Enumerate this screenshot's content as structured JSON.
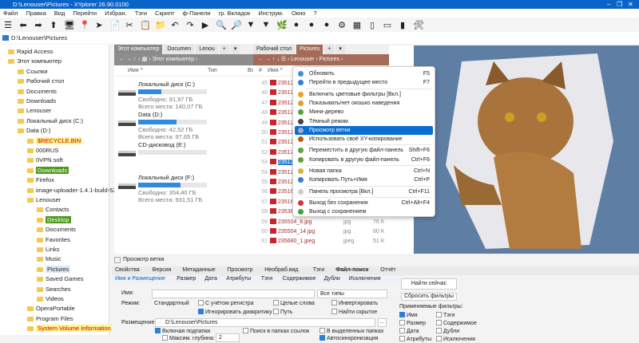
{
  "window": {
    "title": "D:\\Lenouser\\Pictures - XYplorer 26.90.0100",
    "min": "–",
    "max": "❐",
    "close": "✕"
  },
  "menu": [
    "Файл",
    "Правка",
    "Вид",
    "Перейти",
    "Избран.",
    "Тэги",
    "Скрипт",
    "ф-Панели",
    "гр. Вкладок",
    "Инструм.",
    "Окно",
    "?"
  ],
  "toolbar": [
    "☰",
    "⬅",
    "➡",
    "⬆",
    "🖥",
    "📍",
    "➤",
    "📄",
    "✂",
    "📋",
    "📁",
    "↶",
    "↷",
    "▶",
    "🔍",
    "🔎",
    "▼",
    "▼",
    "🌿",
    "●",
    "●",
    "●",
    "⚙",
    "▦",
    "▯",
    "▭",
    "▮",
    "🛠"
  ],
  "address": "D:\\Lenouser\\Pictures",
  "tree": [
    {
      "label": "Rapid Access",
      "lvl": 0
    },
    {
      "label": "Этот компьютер",
      "lvl": 0
    },
    {
      "label": "Ссылки",
      "lvl": 1
    },
    {
      "label": "Рабочий стол",
      "lvl": 1
    },
    {
      "label": "Documents",
      "lvl": 1
    },
    {
      "label": "Downloads",
      "lvl": 1
    },
    {
      "label": "Lenouser",
      "lvl": 1
    },
    {
      "label": "Локальный диск (C:)",
      "lvl": 1
    },
    {
      "label": "Data (D:)",
      "lvl": 1
    },
    {
      "label": "$RECYCLE.BIN",
      "lvl": 2,
      "hl": "y"
    },
    {
      "label": "000RUS",
      "lvl": 2
    },
    {
      "label": "0VPN soft",
      "lvl": 2
    },
    {
      "label": "Downloads",
      "lvl": 2,
      "hl": "g"
    },
    {
      "label": "Firefox",
      "lvl": 2
    },
    {
      "label": "image-uploader-1.4.1-build-5219",
      "lvl": 2
    },
    {
      "label": "Lenouser",
      "lvl": 2
    },
    {
      "label": "Contacts",
      "lvl": 3
    },
    {
      "label": "Desktop",
      "lvl": 3,
      "hl": "g"
    },
    {
      "label": "Documents",
      "lvl": 3
    },
    {
      "label": "Favorites",
      "lvl": 3
    },
    {
      "label": "Links",
      "lvl": 3
    },
    {
      "label": "Music",
      "lvl": 3
    },
    {
      "label": "Pictures",
      "lvl": 3,
      "hl": "s"
    },
    {
      "label": "Saved Games",
      "lvl": 3
    },
    {
      "label": "Searches",
      "lvl": 3
    },
    {
      "label": "Videos",
      "lvl": 3
    },
    {
      "label": "OperaPortable",
      "lvl": 2
    },
    {
      "label": "Program Files",
      "lvl": 2
    },
    {
      "label": "System Volume Information",
      "lvl": 2,
      "hl": "y"
    }
  ],
  "pane1": {
    "tabs": [
      "Этот компьютер",
      "Documen",
      "Lenou",
      "+",
      "▾"
    ],
    "nav": "← → ↑ ↓  ▦  ›  Этот компьютер  ›",
    "cols": [
      "Имя ^",
      "Тип",
      "Вс"
    ],
    "drives": [
      {
        "name": "Локальный диск (C:)",
        "free": "Свободно: 91,97 ГБ",
        "total": "Всего места: 140,07 ГБ",
        "used": 0.34
      },
      {
        "name": "Data (D:)",
        "free": "Свободно: 42,52 ГБ",
        "total": "Всего места: 97,65 ГБ",
        "used": 0.56
      },
      {
        "name": "CD-дисковод (E:)",
        "free": "",
        "total": "",
        "used": 0
      },
      {
        "name": "Локальный диск (F:)",
        "free": "Свободно: 354,40 ГБ",
        "total": "Всего места: 931,51 ГБ",
        "used": 0.62
      }
    ]
  },
  "pane2": {
    "tabs": [
      "Рабочий стол",
      "Pictures",
      "+",
      "▾"
    ],
    "nav": "← → ↑ ↓  ☰  ‹  Lenouser  ›  Pictures  ›",
    "cols": [
      "#",
      "Имя ^"
    ],
    "rows": [
      {
        "n": "45",
        "name": "235128_5"
      },
      {
        "n": "46",
        "name": "235128_6"
      },
      {
        "n": "47",
        "name": "235128_7"
      },
      {
        "n": "48",
        "name": "235128_8"
      },
      {
        "n": "49",
        "name": "235128_9"
      },
      {
        "n": "50",
        "name": "235128_1"
      },
      {
        "n": "51",
        "name": "235128_1"
      },
      {
        "n": "52",
        "name": "235128_1"
      },
      {
        "n": "53",
        "name": "235128_1",
        "sel": true
      },
      {
        "n": "54",
        "name": "235128_1"
      },
      {
        "n": "55",
        "name": "235128_1"
      },
      {
        "n": "56",
        "name": "235168_7"
      },
      {
        "n": "57",
        "name": "235168_1"
      },
      {
        "n": "58",
        "name": "235383_1"
      },
      {
        "n": "59",
        "name": "235504_8.jpg",
        "type": "jpg",
        "size": "76 K"
      },
      {
        "n": "60",
        "name": "235504_14.jpg",
        "type": "jpg",
        "size": "60 K"
      },
      {
        "n": "61",
        "name": "235680_1.jpeg",
        "type": "jpeg",
        "size": "51 K"
      }
    ]
  },
  "context_menu": [
    {
      "label": "Обновить",
      "sc": "F5",
      "c": "#3d8fd8"
    },
    {
      "label": "Перейти в предыдущее место",
      "sc": "F7",
      "c": "#2e7fd6"
    },
    {
      "sep": true
    },
    {
      "label": "Включить цветовые фильтры [Вкл.]",
      "sc": "",
      "c": "#f0a020"
    },
    {
      "label": "Показывать/нет окошко наведения",
      "sc": "",
      "c": "#e0a020"
    },
    {
      "label": "Мини-дерево",
      "sc": "",
      "c": "#5aa040"
    },
    {
      "label": "Тёмный режим",
      "sc": "",
      "c": "#444"
    },
    {
      "label": "Просмотр ветки",
      "sc": "",
      "c": "#aac",
      "hl": true
    },
    {
      "label": "Использовать своё XY-копирование",
      "sc": "",
      "c": "#b06020"
    },
    {
      "sep": true
    },
    {
      "label": "Переместить в другую файл-панель",
      "sc": "Shift+F6",
      "c": "#60a040"
    },
    {
      "label": "Копировать в другую файл-панель",
      "sc": "Ctrl+F6",
      "c": "#60a040"
    },
    {
      "sep": true
    },
    {
      "label": "Новая папка",
      "sc": "Ctrl+N",
      "c": "#e0b030"
    },
    {
      "label": "Копировать Путь+Имя",
      "sc": "Ctrl+P",
      "c": "#2e7fd6"
    },
    {
      "sep": true
    },
    {
      "label": "Панель просмотра [Вкл.]",
      "sc": "Ctrl+F11",
      "c": "#ccc"
    },
    {
      "sep": true
    },
    {
      "label": "Выход без сохранения",
      "sc": "Ctrl+Alt+F4",
      "c": "#d83030"
    },
    {
      "label": "Выход с сохранением",
      "sc": "",
      "c": "#40a040"
    }
  ],
  "bottom": {
    "header": "Просмотр ветки",
    "tabs": [
      "Свойства",
      "Версия",
      "Метаданные",
      "Просмотр",
      "Необраб.вид",
      "Тэги",
      "Файл-поиск",
      "Отчёт"
    ],
    "active_tab": "Файл-поиск",
    "subtabs": [
      "Имя и Размещение",
      "Размер",
      "Дата",
      "Атрибуты",
      "Тэги",
      "Содержимое",
      "Дубли",
      "Исключения"
    ],
    "name_label": "Имя:",
    "name_value": "",
    "types": "Все типы",
    "mode_label": "Режим:",
    "mode": "Стандартный",
    "checks": [
      {
        "label": "С учётом регистра",
        "on": false
      },
      {
        "label": "Игнорировать диакритику",
        "on": true
      },
      {
        "label": "Целые слова",
        "on": false
      },
      {
        "label": "Путь",
        "on": false
      },
      {
        "label": "Инвертировать",
        "on": false
      },
      {
        "label": "Найти скрытое",
        "on": false
      }
    ],
    "location_label": "Размещение:",
    "location": "D:\\Lenouser\\Pictures",
    "browse": "...",
    "checks2": [
      {
        "label": "Включая подпапки",
        "on": true
      },
      {
        "label": "Максим. глубина:",
        "on": false
      },
      {
        "label": "Поиск в папках ссылок",
        "on": false
      },
      {
        "label": "В выделенных папках",
        "on": false
      },
      {
        "label": "Автосинхронизация",
        "on": true
      }
    ],
    "depth": "2",
    "find_now": "Найти сейчас",
    "reset": "Сбросить фильтры",
    "applied_label": "Применяемые фильтры:",
    "filters": [
      {
        "label": "Имя",
        "on": true
      },
      {
        "label": "Размер",
        "on": false
      },
      {
        "label": "Дата",
        "on": false
      },
      {
        "label": "Атрибуты",
        "on": false
      },
      {
        "label": "Тэги",
        "on": false
      },
      {
        "label": "Содержимое",
        "on": false
      },
      {
        "label": "Дубли",
        "on": false
      },
      {
        "label": "Исключения",
        "on": false
      }
    ]
  }
}
